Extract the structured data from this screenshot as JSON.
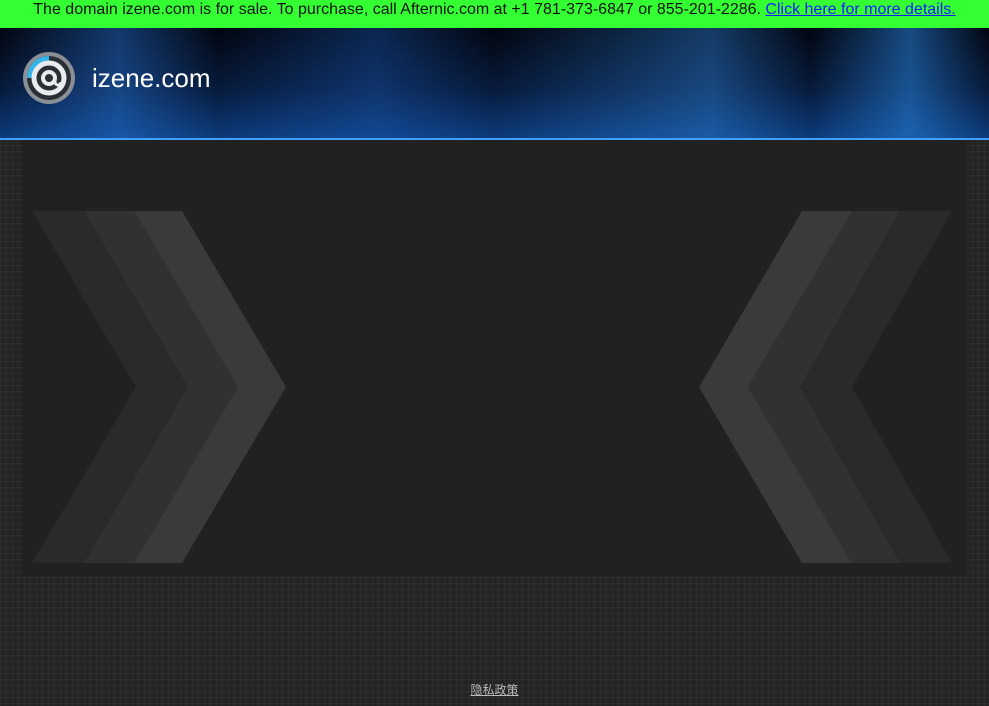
{
  "banner": {
    "text": "The domain izene.com is for sale. To purchase, call Afternic.com at +1 781-373-6847 or 855-201-2286.",
    "link_text": "Click here for more details.",
    "background": "#33ff33"
  },
  "header": {
    "site_name": "izene.com",
    "logo_icon": "at-sign-circle-icon",
    "accent": "#3fa0ff"
  },
  "footer": {
    "privacy_label": "隐私政策"
  }
}
